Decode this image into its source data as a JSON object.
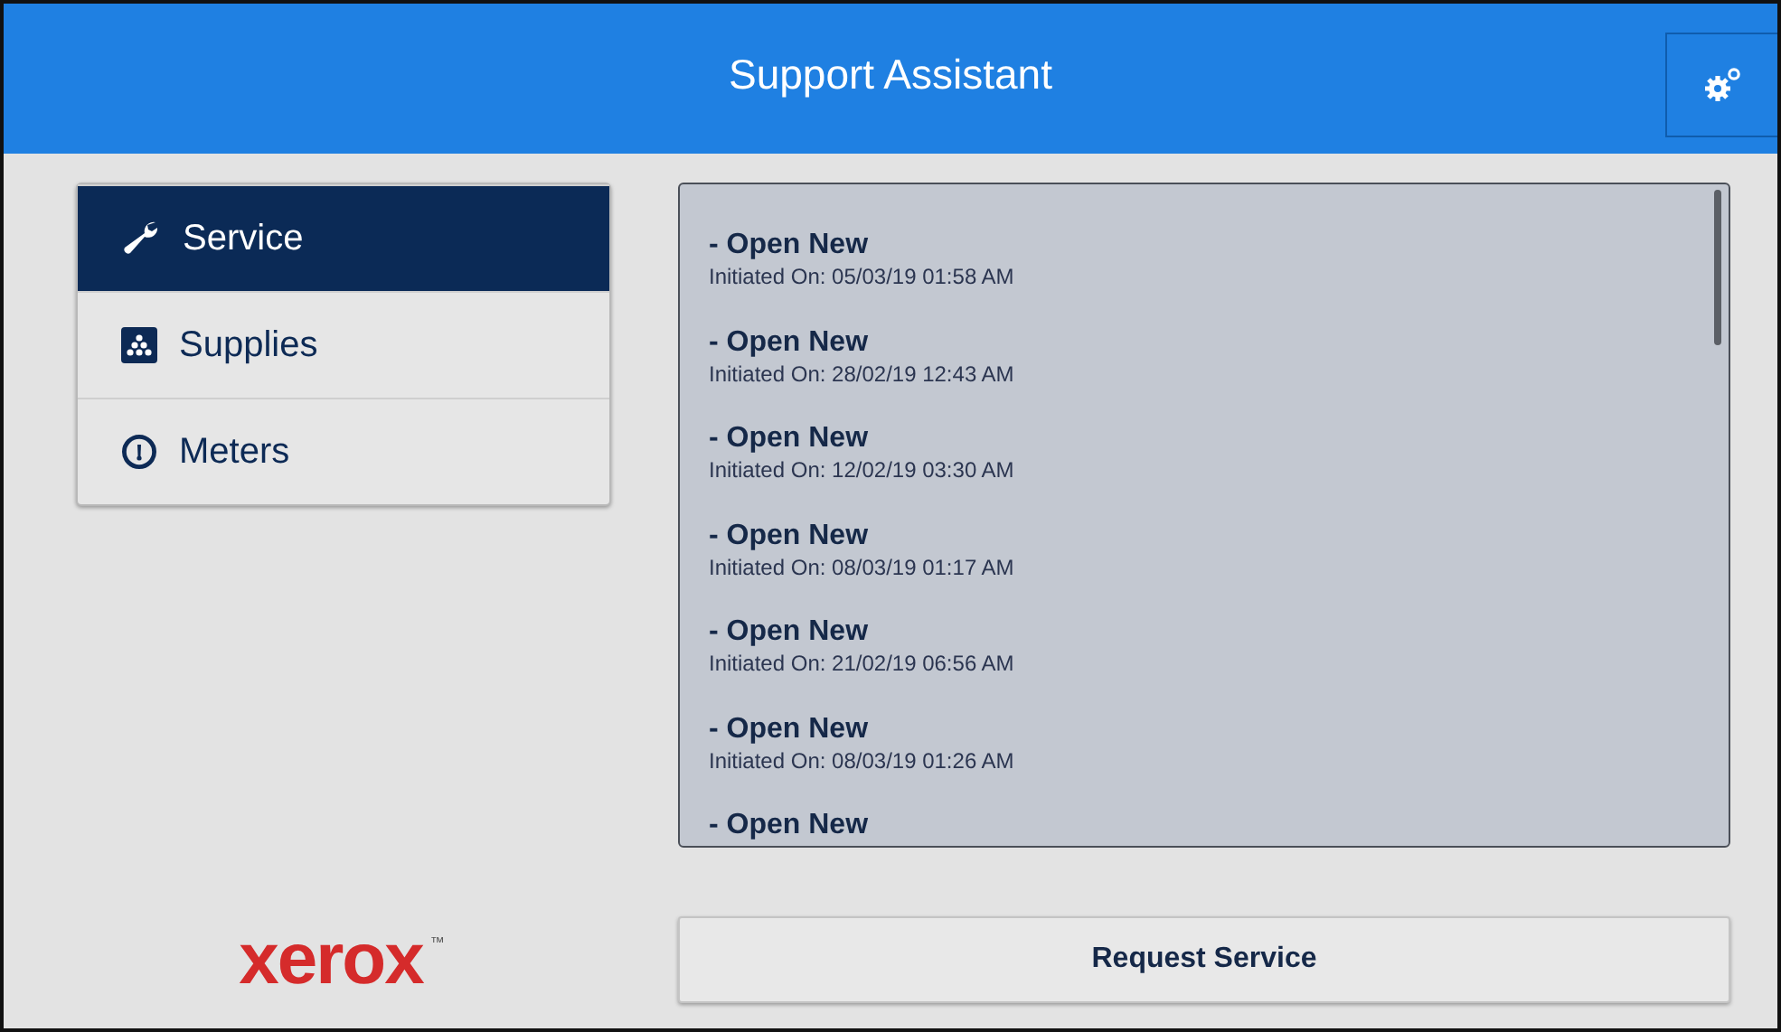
{
  "header": {
    "title": "Support Assistant"
  },
  "nav": [
    {
      "label": "Service",
      "kind": "wrench",
      "selected": true
    },
    {
      "label": "Supplies",
      "kind": "supplies",
      "selected": false
    },
    {
      "label": "Meters",
      "kind": "meter",
      "selected": false
    }
  ],
  "requests": [
    {
      "title": "- Open New",
      "initiated": "Initiated On: 05/03/19 01:58 AM"
    },
    {
      "title": "- Open New",
      "initiated": "Initiated On: 28/02/19 12:43 AM"
    },
    {
      "title": "- Open New",
      "initiated": "Initiated On: 12/02/19 03:30 AM"
    },
    {
      "title": "- Open New",
      "initiated": "Initiated On: 08/03/19 01:17 AM"
    },
    {
      "title": "- Open New",
      "initiated": "Initiated On: 21/02/19 06:56 AM"
    },
    {
      "title": "- Open New",
      "initiated": "Initiated On: 08/03/19 01:26 AM"
    },
    {
      "title": "- Open New"
    }
  ],
  "logo": {
    "text": "xerox",
    "mark": "™"
  },
  "action_button": "Request Service"
}
